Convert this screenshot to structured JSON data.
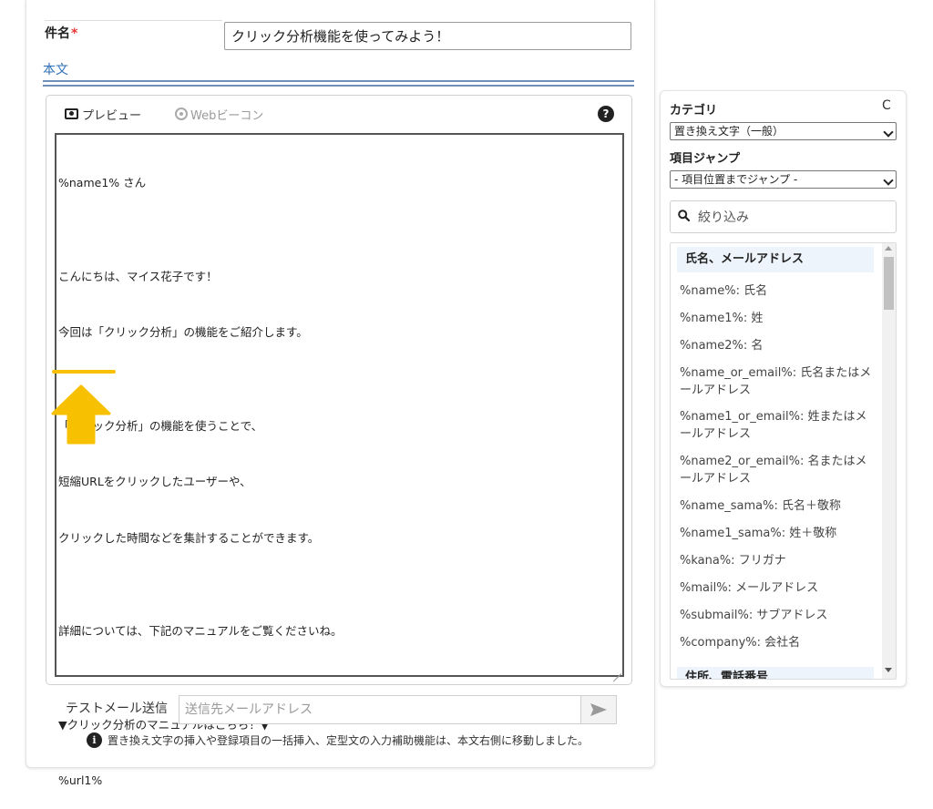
{
  "form": {
    "subject_label": "件名",
    "required_mark": "*",
    "subject_value": "クリック分析機能を使ってみよう！",
    "body_label": "本文"
  },
  "editor": {
    "toolbar": {
      "preview_label": "プレビュー",
      "webbeacon_label": "Webビーコン",
      "help_icon": "?"
    },
    "body_lines": [
      "%name1% さん",
      "",
      "こんにちは、マイス花子です！",
      "今回は「クリック分析」の機能をご紹介します。",
      "",
      "「クリック分析」の機能を使うことで、",
      "短縮URLをクリックしたユーザーや、",
      "クリックした時間などを集計することができます。",
      "",
      "詳細については、下記のマニュアルをご覧くださいね。",
      "",
      "▼クリック分析のマニュアルはこちら！▼",
      "%url1%"
    ]
  },
  "test_mail": {
    "label": "テストメール送信",
    "placeholder": "送信先メールアドレス"
  },
  "notice": {
    "icon": "i",
    "text": "置き換え文字の挿入や登録項目の一括挿入、定型文の入力補助機能は、本文右側に移動しました。"
  },
  "sidebar": {
    "category_label": "カテゴリ",
    "refresh_icon": "C",
    "category_value": "置き換え文字（一般）",
    "jump_label": "項目ジャンプ",
    "jump_value": "- 項目位置までジャンプ -",
    "filter_placeholder": "絞り込み",
    "group_header": "氏名、メールアドレス",
    "items": [
      "%name%: 氏名",
      "%name1%: 姓",
      "%name2%: 名",
      "%name_or_email%: 氏名またはメ",
      "ールアドレス",
      "%name1_or_email%: 姓またはメ",
      "ールアドレス",
      "%name2_or_email%: 名またはメ",
      "ールアドレス",
      "%name_sama%: 氏名＋敬称",
      "%name1_sama%: 姓＋敬称",
      "%kana%: フリガナ",
      "%mail%: メールアドレス",
      "%submail%: サブアドレス",
      "%company%: 会社名"
    ],
    "next_group_header": "住所、電話番号"
  },
  "colors": {
    "accent_blue": "#2e6fb7",
    "required_red": "#e53935",
    "annotation_yellow": "#f7c000",
    "header_bg": "#eef4fb"
  }
}
